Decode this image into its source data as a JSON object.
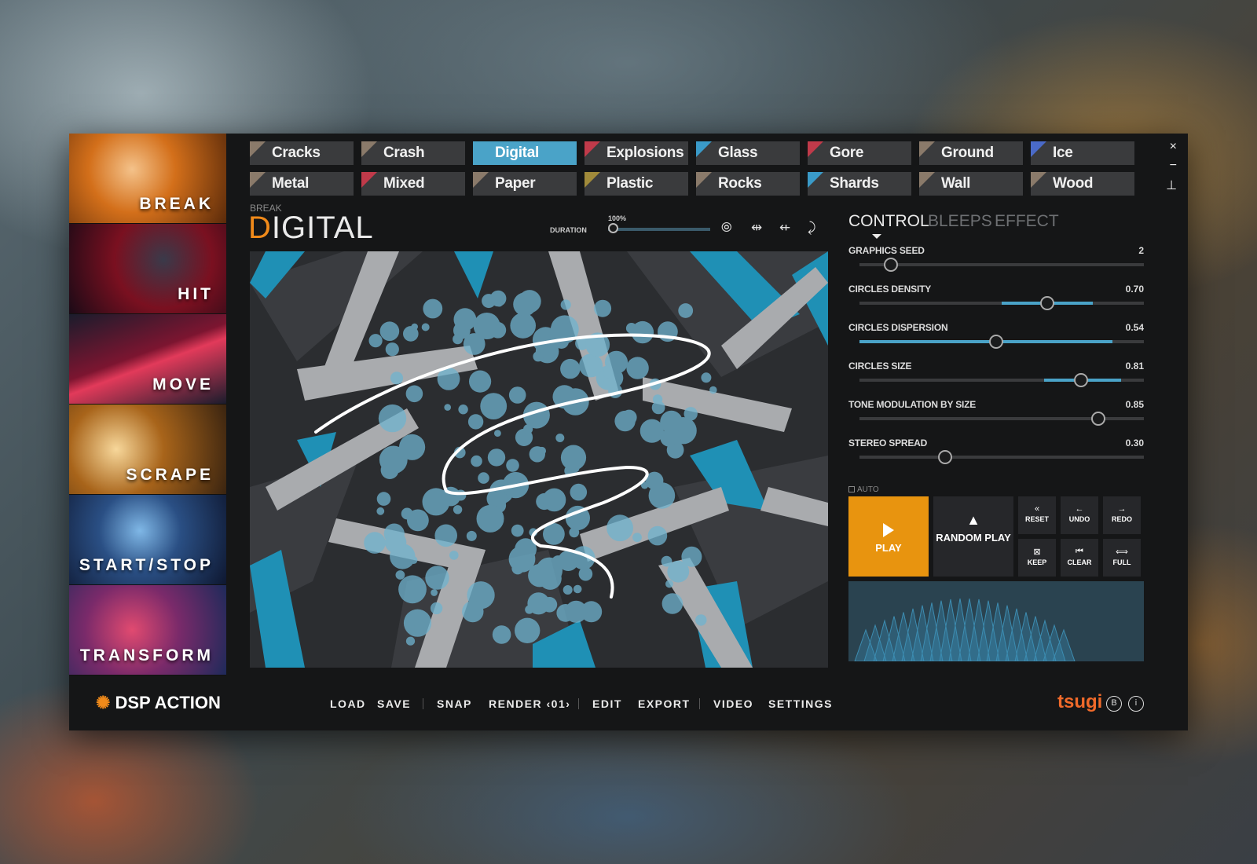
{
  "categories": [
    "BREAK",
    "HIT",
    "MOVE",
    "SCRAPE",
    "START/STOP",
    "TRANSFORM"
  ],
  "tags_row1": [
    {
      "label": "Cracks",
      "color": "#8a7a6a"
    },
    {
      "label": "Crash",
      "color": "#8a7a6a"
    },
    {
      "label": "Digital",
      "color": "#4aa3c8"
    },
    {
      "label": "Explosions",
      "color": "#c03a4a"
    },
    {
      "label": "Glass",
      "color": "#3a9ac8"
    },
    {
      "label": "Gore",
      "color": "#c03a4a"
    },
    {
      "label": "Ground",
      "color": "#8a7a6a"
    },
    {
      "label": "Ice",
      "color": "#4a6ac8"
    }
  ],
  "tags_row2": [
    {
      "label": "Metal",
      "color": "#8a7a6a"
    },
    {
      "label": "Mixed",
      "color": "#c03a4a"
    },
    {
      "label": "Paper",
      "color": "#8a7a6a"
    },
    {
      "label": "Plastic",
      "color": "#a08a3a"
    },
    {
      "label": "Rocks",
      "color": "#8a7a6a"
    },
    {
      "label": "Shards",
      "color": "#3a9ac8"
    },
    {
      "label": "Wall",
      "color": "#8a7a6a"
    },
    {
      "label": "Wood",
      "color": "#8a7a6a"
    }
  ],
  "window": {
    "close": "×",
    "minimize": "−",
    "pin": "⊥"
  },
  "header": {
    "breadcrumb": "BREAK",
    "title_first": "D",
    "title_rest": "IGITAL",
    "duration_label": "DURATION",
    "duration_value": "100%",
    "duration_fraction": 0.0
  },
  "tools": [
    "⦾",
    "⇹",
    "⇷",
    "⤸"
  ],
  "tabs": [
    "CONTROL",
    "BLEEPS",
    "EFFECT"
  ],
  "active_tab": "CONTROL",
  "sliders": [
    {
      "name": "GRAPHICS SEED",
      "value": "2",
      "knob": 0.11,
      "range": null
    },
    {
      "name": "CIRCLES DENSITY",
      "value": "0.70",
      "knob": 0.66,
      "range": [
        0.5,
        0.82
      ]
    },
    {
      "name": "CIRCLES DISPERSION",
      "value": "0.54",
      "knob": 0.48,
      "range": [
        0.0,
        0.89
      ]
    },
    {
      "name": "CIRCLES SIZE",
      "value": "0.81",
      "knob": 0.78,
      "range": [
        0.65,
        0.92
      ]
    },
    {
      "name": "TONE MODULATION BY SIZE",
      "value": "0.85",
      "knob": 0.84,
      "range": null
    },
    {
      "name": "STEREO SPREAD",
      "value": "0.30",
      "knob": 0.3,
      "range": null
    }
  ],
  "auto_label": "AUTO",
  "play_label": "PLAY",
  "random_play_label": "RANDOM PLAY",
  "small_buttons": [
    {
      "label": "RESET",
      "icon": "«"
    },
    {
      "label": "UNDO",
      "icon": "←"
    },
    {
      "label": "REDO",
      "icon": "→"
    },
    {
      "label": "KEEP",
      "icon": "⊠"
    },
    {
      "label": "CLEAR",
      "icon": "⏮"
    },
    {
      "label": "FULL",
      "icon": "⟺"
    }
  ],
  "footer": {
    "logo": "DSP ACTION",
    "menu": [
      "LOAD",
      "SAVE",
      "SNAP",
      "RENDER ‹01›",
      "EDIT",
      "EXPORT",
      "VIDEO",
      "SETTINGS"
    ],
    "brand": "tsugi",
    "help_icon": "B",
    "info_icon": "i"
  },
  "colors": {
    "accent": "#4aa3c8",
    "play": "#e8940f",
    "title_accent": "#f08a1a"
  }
}
